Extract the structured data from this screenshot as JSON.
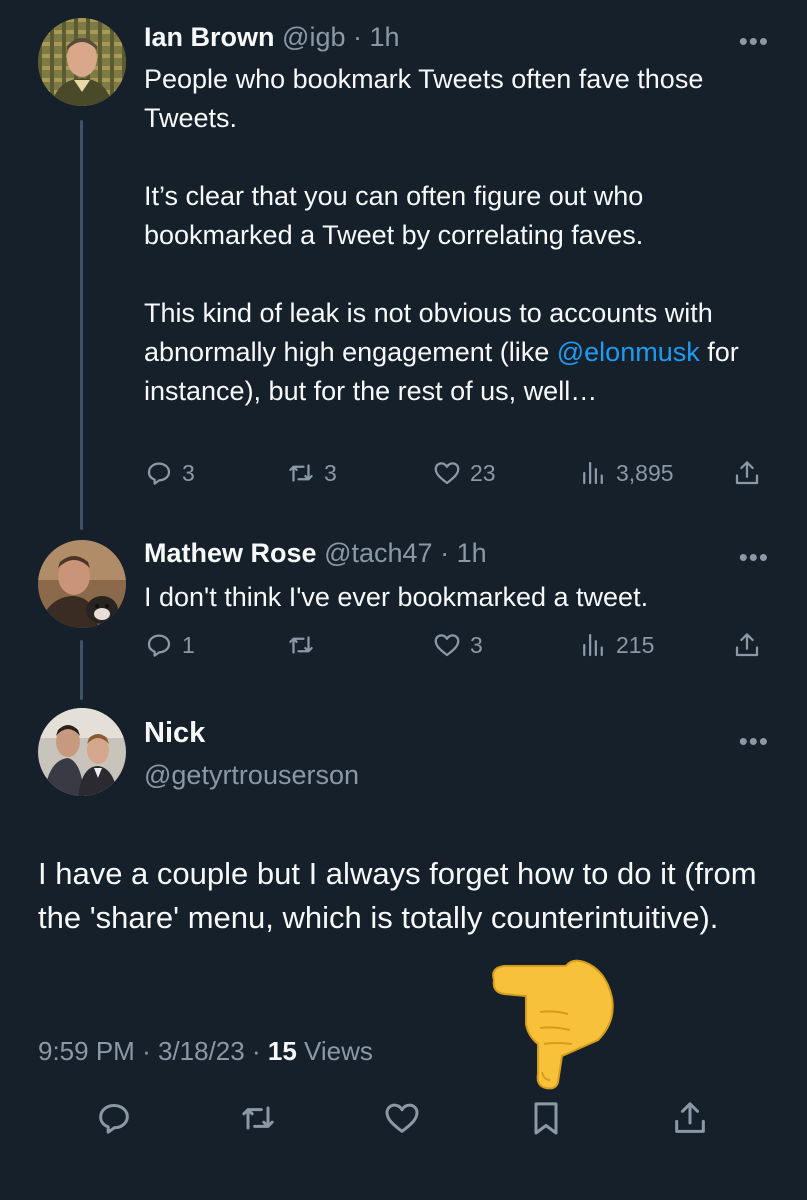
{
  "tweets": [
    {
      "name": "Ian Brown",
      "handle": "@igb",
      "separator": "·",
      "time": "1h",
      "paragraphs": [
        "People who bookmark Tweets often fave those Tweets.",
        "It’s clear that you can often figure out who bookmarked a Tweet by correlating faves."
      ],
      "para3_before": "This kind of leak is not obvious to accounts with abnormally high engagement (like ",
      "para3_mention": "@elonmusk",
      "para3_after": " for instance), but for the rest of us, well…",
      "replies": "3",
      "retweets": "3",
      "likes": "23",
      "views": "3,895"
    },
    {
      "name": "Mathew Rose",
      "handle": "@tach47",
      "separator": "·",
      "time": "1h",
      "text": "I don't think I've ever bookmarked a tweet.",
      "replies": "1",
      "retweets": "",
      "likes": "3",
      "views": "215"
    }
  ],
  "main_tweet": {
    "name": "Nick",
    "handle": "@getyrtrouserson",
    "text": "I have a couple but I always forget how to do it (from the 'share' menu, which is totally counterintuitive).",
    "time": "9:59 PM",
    "separator": "·",
    "date": "3/18/23",
    "views_count": "15",
    "views_label": "Views"
  },
  "more_icon": "•••",
  "icons": [
    "reply-icon",
    "retweet-icon",
    "like-icon",
    "views-icon",
    "share-icon",
    "bookmark-icon",
    "pointing-hand-emoji"
  ],
  "colors": {
    "background": "#15202b",
    "text": "#f7f9f9",
    "muted": "#8b98a5",
    "accent": "#1d9bf0"
  }
}
